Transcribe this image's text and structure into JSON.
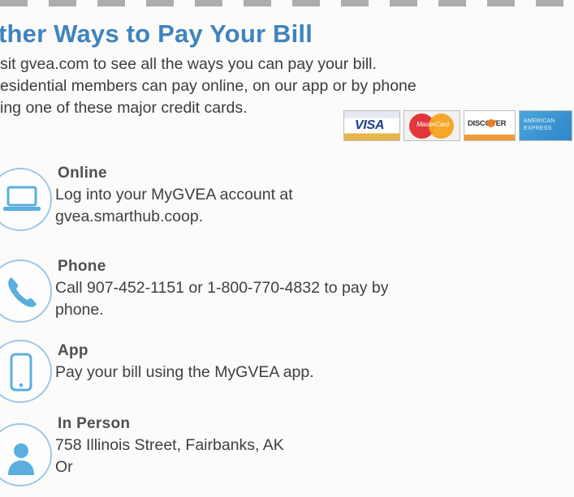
{
  "title": "ther Ways to Pay Your Bill",
  "intro": {
    "line1": "sit gvea.com to see all the ways you can pay your bill.",
    "line2": "esidential members can pay online, on our app or by phone",
    "line3": "ing one of these major credit cards."
  },
  "cards": {
    "visa": "VISA",
    "mastercard": "MasterCard",
    "discover": "DISCOVER",
    "amex": "AMERICAN EXPRESS"
  },
  "methods": {
    "online": {
      "icon": "laptop-icon",
      "heading": "Online",
      "line1": "Log into your MyGVEA account at",
      "line2": "gvea.smarthub.coop."
    },
    "phone": {
      "icon": "phone-icon",
      "heading": "Phone",
      "line1": "Call 907-452-1151 or 1-800-770-4832 to pay by",
      "line2": "phone."
    },
    "app": {
      "icon": "mobile-icon",
      "heading": "App",
      "line1": "Pay your bill using the MyGVEA app."
    },
    "in_person": {
      "icon": "person-icon",
      "heading": "In Person",
      "line1": "758 Illinois Street, Fairbanks, AK",
      "line2": "Or"
    }
  },
  "colors": {
    "title": "#3f83bf",
    "icon_accent": "#5aaee0",
    "text": "#3f3f3f"
  }
}
